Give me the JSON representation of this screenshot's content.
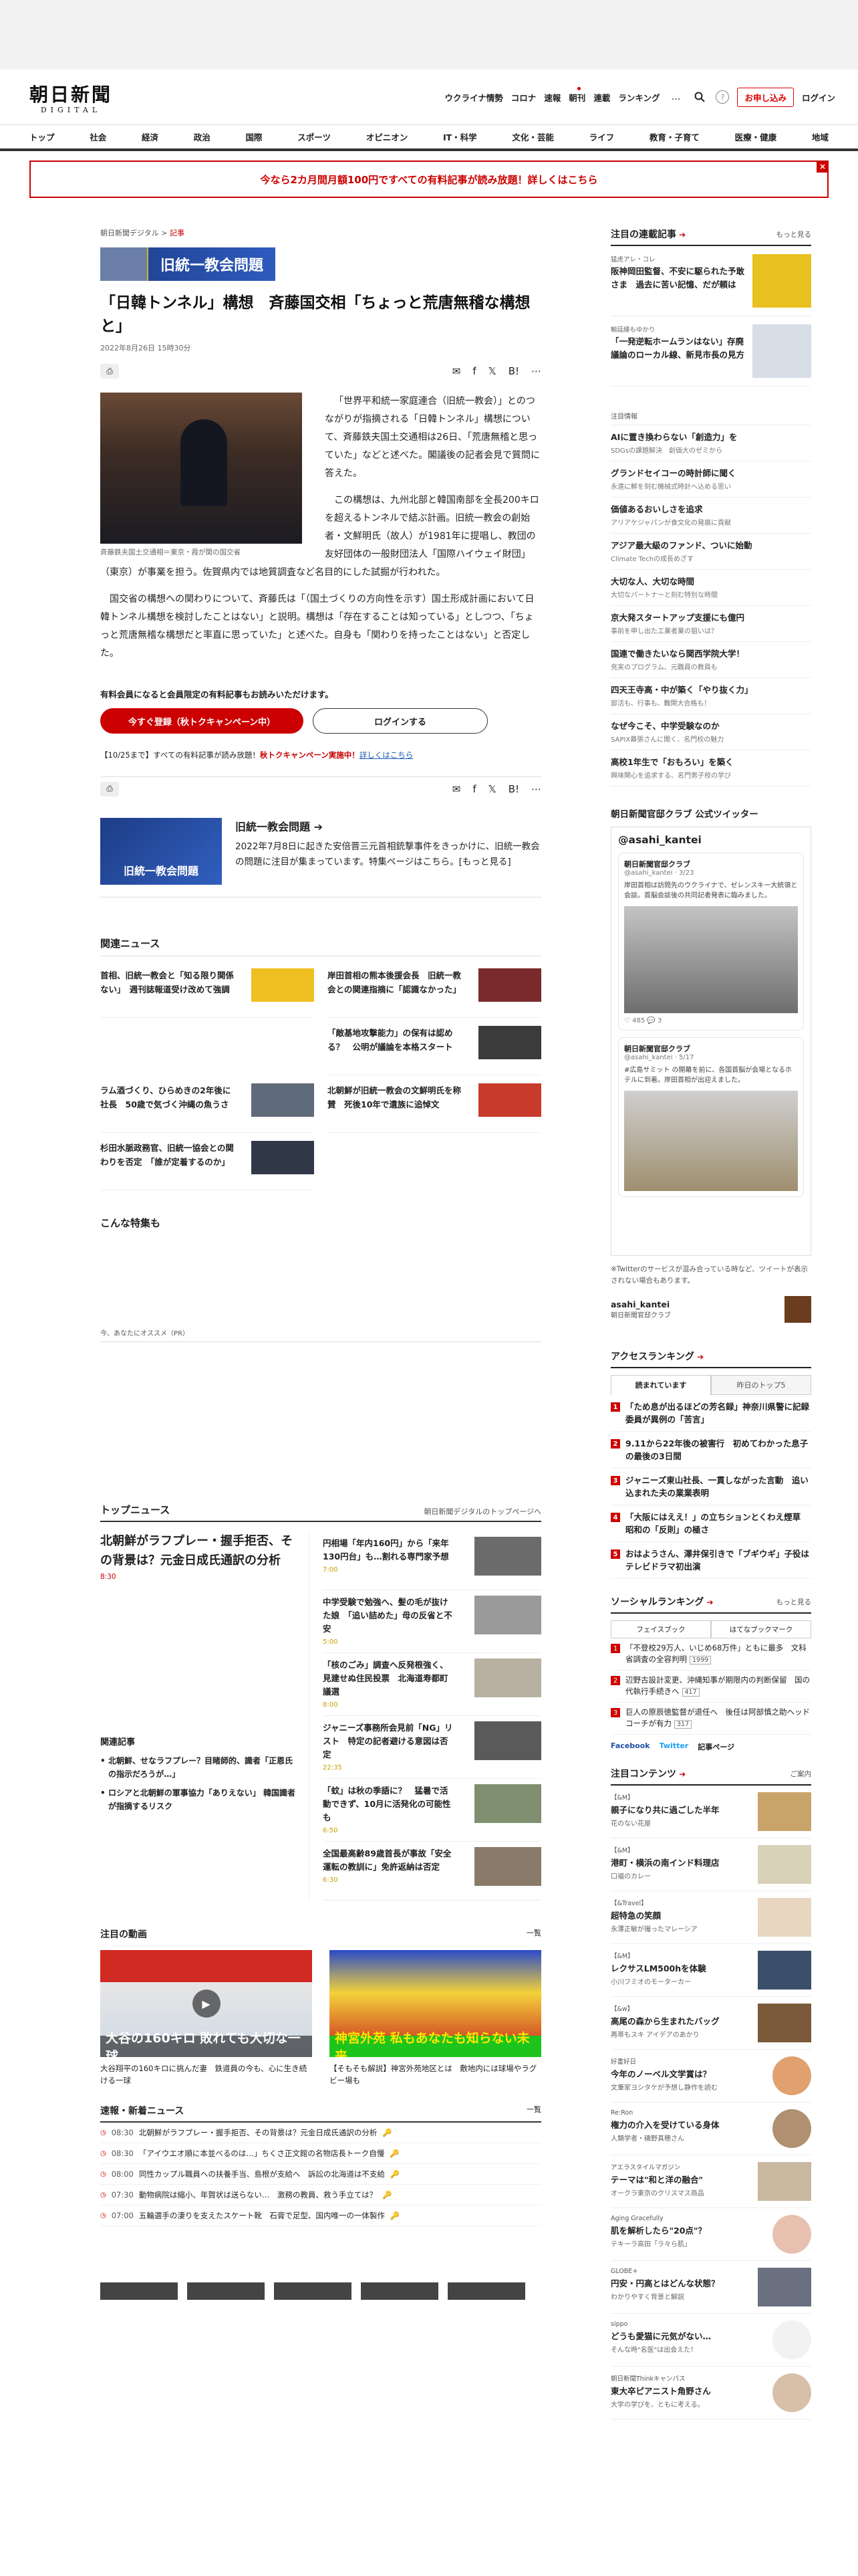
{
  "header": {
    "logo_main": "朝日新聞",
    "logo_sub": "DIGITAL",
    "util_links": [
      "ウクライナ情勢",
      "コロナ",
      "速報",
      "朝刊",
      "連載",
      "ランキング"
    ],
    "more": "…",
    "help": "?",
    "subscribe": "お申し込み",
    "login": "ログイン"
  },
  "gnav": [
    "トップ",
    "社会",
    "経済",
    "政治",
    "国際",
    "スポーツ",
    "オピニオン",
    "IT・科学",
    "文化・芸能",
    "ライフ",
    "教育・子育て",
    "医療・健康",
    "地域"
  ],
  "banner": {
    "text": "今なら2カ月間月額100円ですべての有料記事が読み放題！詳しくはこちら",
    "close": "×"
  },
  "article": {
    "crumb_site": "朝日新聞デジタル",
    "crumb_sep": " > ",
    "crumb_type": "記事",
    "topic": "旧統一教会問題",
    "title": "「日韓トンネル」構想　斉藤国交相「ちょっと荒唐無稽な構想と」",
    "date": "2022年8月26日 15時30分",
    "photo_caption": "斉藤鉄夫国土交通相＝東京・霞が関の国交省",
    "paragraphs": [
      "「世界平和統一家庭連合（旧統一教会）」とのつながりが指摘される「日韓トンネル」構想について、斉藤鉄夫国土交通相は26日、「荒唐無稽と思っていた」などと述べた。閣議後の記者会見で質問に答えた。",
      "この構想は、九州北部と韓国南部を全長200キロを超えるトンネルで結ぶ計画。旧統一教会の創始者・文鮮明氏（故人）が1981年に提唱し、教団の友好団体の一般財団法人「国際ハイウェイ財団」（東京）が事業を担う。佐賀県内では地質調査など名目的にした試掘が行われた。",
      "国交省の構想への関わりについて、斉藤氏は「（国土づくりの方向性を示す）国土形成計画において日韓トンネル構想を検討したことはない」と説明。構想は「存在することは知っている」としつつ、「ちょっと荒唐無稽な構想だと率直に思っていた」と述べた。自身も「関わりを持ったことはない」と否定した。"
    ],
    "members_notice": "有料会員になると会員限定の有料記事もお読みいただけます。",
    "register_btn": "今すぐ登録（秋トクキャンペーン中）",
    "login_btn": "ログインする",
    "campaign_pre": "【10/25まで】すべての有料記事が読み放題！",
    "campaign_red": "秋トクキャンペーン実施中！",
    "campaign_link": "詳しくはこちら",
    "print_icon": "⎙",
    "share_icons": [
      "✉",
      "f",
      "𝕏",
      "B!",
      "⋯"
    ],
    "share_sub": "list"
  },
  "series": {
    "img_label": "旧統一教会問題",
    "title": "旧統一教会問題 ➔",
    "desc": "2022年7月8日に起きた安倍晋三元首相銃撃事件をきっかけに、旧統一教会の問題に注目が集まっています。特集ページはこちら。[もっと見る]"
  },
  "related": {
    "heading": "関連ニュース",
    "items": [
      {
        "title": "首相、旧統一教会と「知る限り関係ない」　週刊誌報道受け改めて強調",
        "color": "#f0c022"
      },
      {
        "title": "岸田首相の熊本後援会長　旧統一教会との関連指摘に「認識なかった」",
        "color": "#7a2a2a"
      },
      {
        "title": "",
        "color": "#ffffff"
      },
      {
        "title": "「敵基地攻撃能力」の保有は認める？　公明が議論を本格スタート",
        "color": "#3b3b3b"
      },
      {
        "title": "ラム酒づくり、ひらめきの2年後に社長　50歳で気づく沖縄の魚うさ",
        "color": "#5f6a7a"
      },
      {
        "title": "北朝鮮が旧統一教会の文鮮明氏を称賛　死後10年で遺族に追悼文",
        "color": "#c83a2a"
      },
      {
        "title": "杉田水脈政務官、旧統一協会との関わりを否定　「誰が定着するのか」",
        "color": "#303848"
      }
    ]
  },
  "special": {
    "heading": "こんな特集も"
  },
  "recommend": {
    "label": "今、あなたにオススメ（PR）"
  },
  "topnews": {
    "heading": "トップニュース",
    "link": "朝日新聞デジタルのトップページへ",
    "lead_title": "北朝鮮がラフプレー・握手拒否、その背景は？元金日成氏通訳の分析",
    "lead_time": "8:30",
    "rel_heading": "関連記事",
    "rel_items": [
      "北朝鮮、せなラフプレー？目睹師的、識者「正恩氏の指示だろうが…」",
      "ロシアと北朝鮮の軍事協力「ありえない」 韓国識者が指摘するリスク"
    ],
    "items": [
      {
        "title": "円相場「年内160円」から「来年130円台」も…割れる専門家予想",
        "time": "7:00",
        "color": "#6b6b6b"
      },
      {
        "title": "中学受験で勉強へ、髪の毛が抜けた娘　「追い詰めた」母の反省と不安",
        "time": "5:00",
        "color": "#9a9a9a"
      },
      {
        "title": "「核のごみ」調査へ反発根強く、見建せぬ住民投票　北海道寿都町議選",
        "time": "8:00",
        "color": "#b8b0a0"
      },
      {
        "title": "ジャニーズ事務所会見前「NG」リスト　特定の記者避ける意図は否定",
        "time": "22:35",
        "color": "#5a5a5a"
      },
      {
        "title": "「蚊」は秋の季語に？　猛暑で活動できず、10月に活発化の可能性も",
        "time": "6:50",
        "color": "#7f8f70"
      },
      {
        "title": "全国最高齢89歳首長が事故「安全運転の教訓に」免許返納は否定",
        "time": "6:30",
        "color": "#8a7a6a"
      }
    ]
  },
  "videos": {
    "heading": "注目の動画",
    "more": "一覧",
    "items": [
      {
        "overlay": "大谷の160キロ 敗れても大切な一球",
        "title": "大谷翔平の160キロに挑んだ妻　鉄道員の今も、心に生き続ける一球"
      },
      {
        "overlay": "神宮外苑 私もあなたも知らない未来",
        "title": "【そもそも解説】神宮外苑地区とは　敷地内には球場やラグビー場も"
      }
    ],
    "play_icon": "▶"
  },
  "breaking": {
    "heading": "速報・新着ニュース",
    "more": "一覧",
    "items": [
      {
        "time": "08:30",
        "title": "北朝鮮がラフプレー・握手拒否、その背景は？元金日成氏通訳の分析"
      },
      {
        "time": "08:30",
        "title": "「アイウエオ順に本並べるのは…」ちくさ正文館の名物店長トーク自慢"
      },
      {
        "time": "08:00",
        "title": "同性カップル職員への扶養手当、島根が支給へ　訴訟の北海道は不支給"
      },
      {
        "time": "07:30",
        "title": "動物病院は縮小、年賀状は送らない…　激務の教員、救う手立ては？"
      },
      {
        "time": "07:00",
        "title": "五輪選手の淒りを支えたスケート靴　石膏で足型、国内唯一の一体製作"
      }
    ],
    "key_icon": "🔑"
  },
  "sidebar": {
    "series_heading": "注目の連載記事",
    "more": "もっと見る",
    "series_items": [
      {
        "src": "猛虎アレ・コレ",
        "title": "阪神岡田監督、不安に駆られた予敢さま　過去に苦い記憶、だが頼は"
      },
      {
        "src": "輸廷縁もゆかり",
        "title": "「一発逆転ホームランはない」存廃議論のローカル線、新見市長の見方"
      }
    ],
    "nf_label": "注目情報",
    "nf_items": [
      {
        "t": "AIに置き換わらない「創造力」を",
        "s": "SDGsの課題解決　創価大のゼミから"
      },
      {
        "t": "グランドセイコーの時計師に聞く",
        "s": "永遠に鮮を刻む機械式時計へ込める思い"
      },
      {
        "t": "価値あるおいしさを追求",
        "s": "アリアケジャパンが食文化の発展に貢献"
      },
      {
        "t": "アジア最大級のファンド、ついに始動",
        "s": "Climate Techの成長めざす"
      },
      {
        "t": "大切な人、大切な時間",
        "s": "大切なパートナーと刻む特別な時間"
      },
      {
        "t": "京大発スタートアップ支援にも億円",
        "s": "事前を申し出た工業者業の狙いは？"
      },
      {
        "t": "国連で働きたいなら関西学院大学！",
        "s": "充実のプログラム、元職員の教員も"
      },
      {
        "t": "四天王寺高・中が築く「やり抜く力」",
        "s": "部活も、行事も、難関大合格も！"
      },
      {
        "t": "なぜ今こそ、中学受験なのか",
        "s": "SAPIX幕張さんに聞く、名門校の魅力"
      },
      {
        "t": "高校1年生で「おもろい」を築く",
        "s": "興味関心を追求する、名門男子校の学び"
      }
    ],
    "twitter_heading": "朝日新聞官邸クラブ 公式ツイッター",
    "twitter_account": "@asahi_kantei",
    "tweets": [
      {
        "name": "朝日新聞官邸クラブ",
        "handle": "@asahi_kantei · 3/23",
        "body": "岸田首相は訪問先のウクライナで、ゼレンスキー大統領と会談。首脳会談後の共同記者発表に臨みました。"
      },
      {
        "name": "朝日新聞官邸クラブ",
        "handle": "@asahi_kantei · 5/17",
        "body": "#広島サミット の開幕を前に、各国首脳が会場となるホテルに到着。岸田首相が出迎えました。"
      }
    ],
    "tweet_counts": "♡ 485  💬 3",
    "twitter_note": "※Twitterのサービスが混み合っている時など、ツイートが表示されない場合もあります。",
    "acc_name": "asahi_kantei",
    "acc_sub": "朝日新聞官邸クラブ",
    "rank_heading": "アクセスランキング",
    "rank_tabs": [
      "読まれています",
      "昨日のトップ5"
    ],
    "rank_items": [
      "「ため息が出るほどの芳名録」神奈川県警に記録委員が異例の「苦言」",
      "9.11から22年後の被害行　初めてわかった息子の最後の3日間",
      "ジャニーズ東山社長、一貫しながった言動　追い込まれた夫の業業表明",
      "「大阪にはええ！」の立ちションとくわえ煙草　昭和の「反則」の極さ",
      "おはようさん、澤井保引きで「ブギウギ」子役はテレビドラマ初出演"
    ],
    "social_heading": "ソーシャルランキング",
    "social_tabs": [
      "フェイスブック",
      "はてなブックマーク"
    ],
    "social_items": [
      {
        "t": "「不登校29万人、いじめ68万件」ともに最多　文科省調査の全容判明",
        "c": "1999"
      },
      {
        "t": "辺野古設計変更、沖縄知事が期限内の判断保留　国の代執行手続きへ",
        "c": "417"
      },
      {
        "t": "巨人の原辰徳監督が退任へ　後任は阿部慎之助ヘッドコーチが有力",
        "c": "317"
      }
    ],
    "follow": [
      "Facebook",
      "Twitter",
      "記事ページ"
    ],
    "content_heading": "注目コンテンツ",
    "content_more": "ご案内",
    "content_items": [
      {
        "cat": "【&M】",
        "t": "親子になり共に過ごした半年",
        "s": "花のない花屋",
        "c": "#c9a46a",
        "r": false
      },
      {
        "cat": "【&M】",
        "t": "港町・横浜の南インド料理店",
        "s": "口福のカレー",
        "c": "#d9d2b8",
        "r": false
      },
      {
        "cat": "【&Travel】",
        "t": "超特急の笑顔",
        "s": "永澤正敏が撮ったマレーシア",
        "c": "#e8d6c0",
        "r": false
      },
      {
        "cat": "【&M】",
        "t": "レクサスLM500hを体験",
        "s": "小川フミオのモーターカー",
        "c": "#3b4f6a",
        "r": false
      },
      {
        "cat": "【&w】",
        "t": "高尾の森から生まれたバッグ",
        "s": "再帯もスキ アイデアのあかり",
        "c": "#7a5a3a",
        "r": false
      },
      {
        "cat": "好書好日",
        "t": "今年のノーベル文学賞は？",
        "s": "文筆家ヨシタケが予想し静作を読む",
        "c": "#e0a070",
        "r": true
      },
      {
        "cat": "Re:Ron",
        "t": "権力の介入を受けている身体",
        "s": "人類学者・磯野真穂さん",
        "c": "#b09070",
        "r": true
      },
      {
        "cat": "アエラスタイルマガジン",
        "t": "テーマは\"和と洋の融合\"",
        "s": "オークラ東京のクリスマス商品",
        "c": "#c8b8a0",
        "r": false
      },
      {
        "cat": "Aging Gracefully",
        "t": "肌を解析したら\"20点\"？",
        "s": "テキーラ高田「ラ々ら肌」",
        "c": "#e7c0b0",
        "r": true
      },
      {
        "cat": "GLOBE+",
        "t": "円安・円高とはどんな状態？",
        "s": "わかりやすく背景と解説",
        "c": "#6a7080",
        "r": false
      },
      {
        "cat": "sippo",
        "t": "どうも愛猫に元気がない…",
        "s": "そんな時\"名医\"は出会えた！",
        "c": "#f2f2f2",
        "r": true
      },
      {
        "cat": "朝日新聞Thinkキャンパス",
        "t": "東大卒ピアニスト角野さん",
        "s": "大学の学びを、ともに考える。",
        "c": "#d8c0a8",
        "r": true
      }
    ]
  },
  "colors": {
    "accent": "#cc0000",
    "brand_blue": "#1c3e88"
  }
}
